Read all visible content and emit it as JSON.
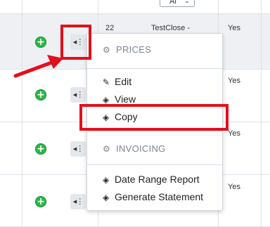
{
  "filter": {
    "selected": "Al"
  },
  "rows": [
    {
      "number": "22",
      "name": "TestClose -",
      "status": "Yes"
    },
    {
      "number": "",
      "name": "",
      "status": "Yes"
    },
    {
      "number": "",
      "name": "",
      "status": "Yes"
    },
    {
      "number": "",
      "name": "",
      "status": "Yes"
    }
  ],
  "menu": {
    "sections": [
      {
        "header": "PRICES",
        "header_icon": "gears-icon",
        "items": [
          {
            "label": "Edit",
            "icon": "edit-icon"
          },
          {
            "label": "View",
            "icon": "eraser-icon"
          },
          {
            "label": "Copy",
            "icon": "eraser-icon"
          }
        ]
      },
      {
        "header": "INVOICING",
        "header_icon": "gears-icon",
        "items": [
          {
            "label": "Date Range Report",
            "icon": "eraser-icon"
          },
          {
            "label": "Generate Statement",
            "icon": "eraser-icon"
          }
        ]
      }
    ]
  },
  "colors": {
    "highlight": "#e2101c",
    "add": "#2db84a"
  }
}
